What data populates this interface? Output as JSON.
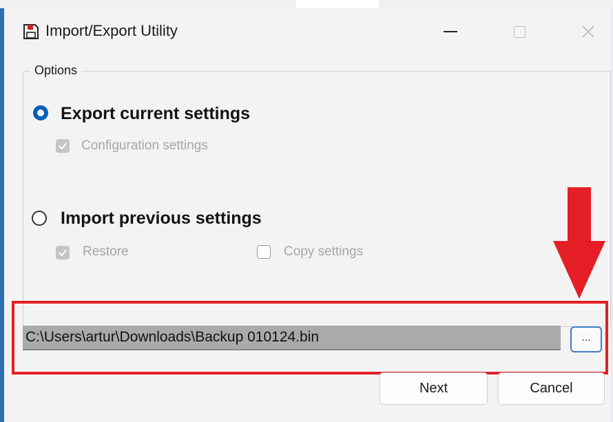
{
  "window": {
    "title": "Import/Export Utility",
    "icon": "floppy-disk-icon"
  },
  "titlebar_controls": {
    "minimize_icon": "minimize-icon",
    "maximize_icon": "maximize-icon",
    "close_icon": "close-icon"
  },
  "options": {
    "group_label": "Options",
    "export": {
      "label": "Export current settings",
      "selected": true,
      "checkboxes": [
        {
          "label": "Configuration settings",
          "checked": true,
          "enabled": false
        }
      ]
    },
    "import": {
      "label": "Import previous settings",
      "selected": false,
      "checkboxes": [
        {
          "label": "Restore",
          "checked": true,
          "enabled": false
        },
        {
          "label": "Copy settings",
          "checked": false,
          "enabled": false
        }
      ]
    }
  },
  "file": {
    "path": "C:\\Users\\artur\\Downloads\\Backup 010124.bin",
    "browse_label": "..."
  },
  "buttons": {
    "next": "Next",
    "cancel": "Cancel"
  },
  "colors": {
    "accent": "#005fb8",
    "highlight": "#e51e25",
    "window_bg": "#f3f3f3"
  }
}
